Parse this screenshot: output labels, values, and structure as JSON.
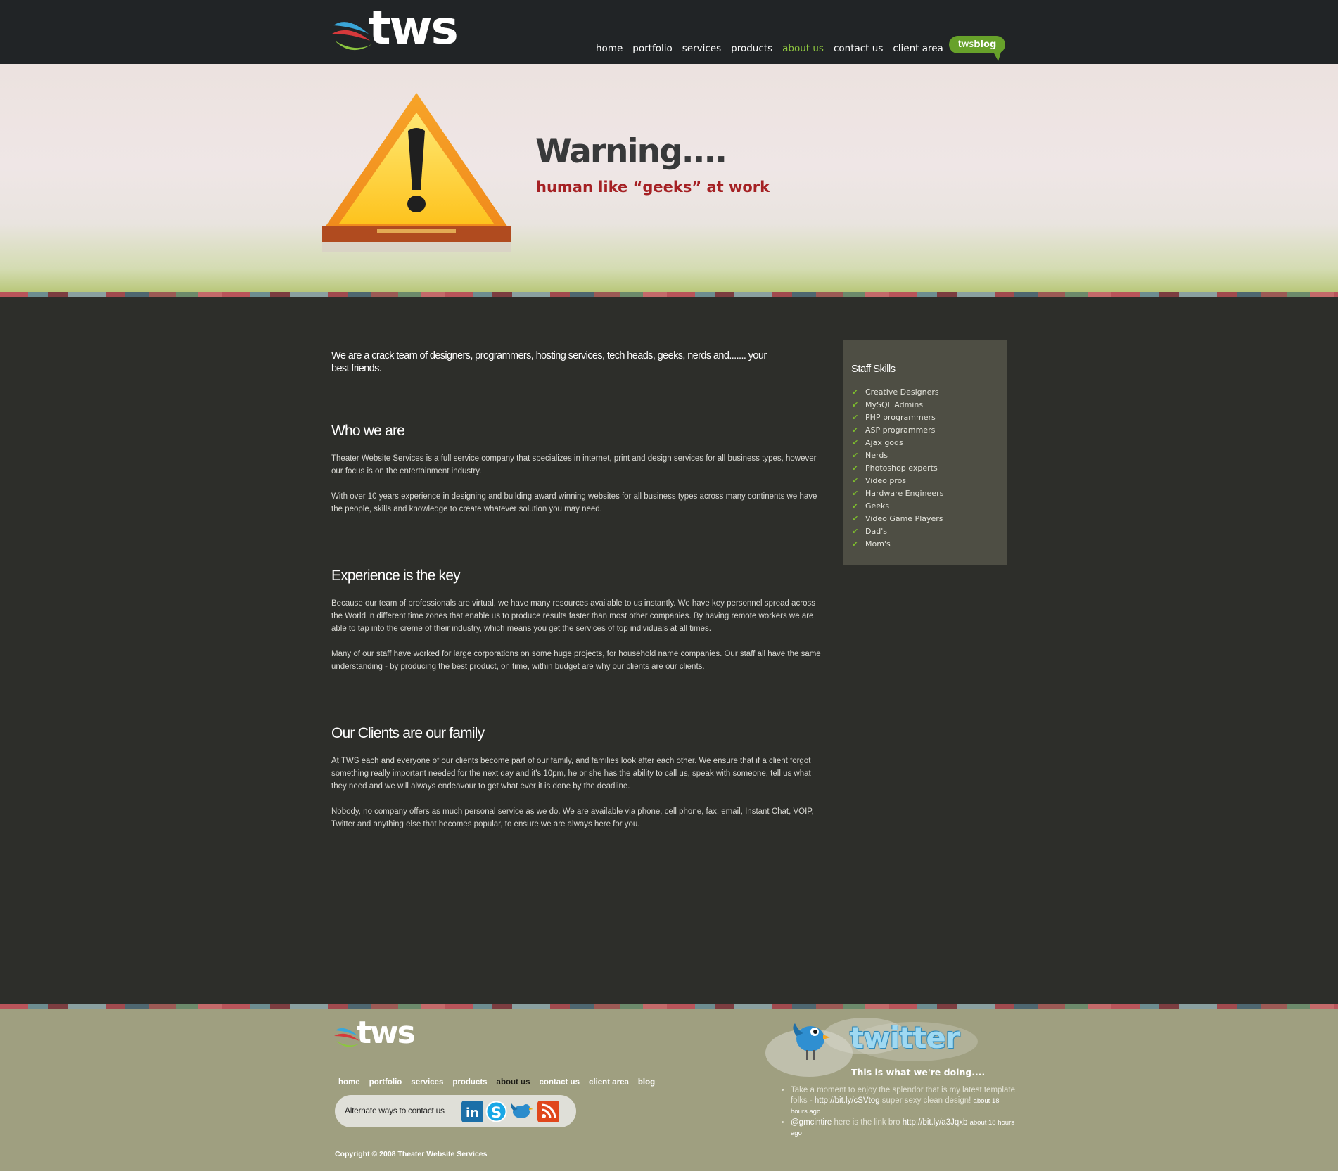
{
  "header": {
    "logo_text": "tws",
    "nav": [
      "home",
      "portfolio",
      "services",
      "products",
      "about us",
      "contact us",
      "client area"
    ],
    "active_nav": "about us",
    "blog_prefix": "tws",
    "blog_suffix": "blog"
  },
  "hero": {
    "title": "Warning....",
    "subtitle": "human like “geeks” at work"
  },
  "intro": "We are a crack team of designers, programmers, hosting services, tech heads, geeks, nerds and....... your best friends.",
  "sections": [
    {
      "heading": "Who we are",
      "paragraphs": [
        "Theater Website Services is a full service company that specializes in internet, print and design services for all business types, however our focus is on the entertainment industry.",
        "With over 10 years experience in designing and building award winning websites for all business types across many continents we have the people, skills and knowledge to create whatever solution you may need."
      ]
    },
    {
      "heading": "Experience is the key",
      "paragraphs": [
        "Because our team of professionals are virtual, we have many resources available to us instantly. We have key personnel spread across the World in different time zones that enable us to produce results faster than most other companies. By having remote workers we are able to tap into the creme of their industry, which means you get the services of top individuals at all times.",
        "Many of our staff have worked for large corporations on some huge projects, for household name companies. Our staff all have the same understanding - by producing the best product, on time, within budget are why our clients are our clients."
      ]
    },
    {
      "heading": "Our Clients are our family",
      "paragraphs": [
        "At TWS each and everyone of our clients become part of our family, and families look after each other. We ensure that if a client forgot something really important needed for the next day and it's 10pm, he or she has the ability to call us, speak with someone, tell us what they need and we will always endeavour to get what ever it is done by the deadline.",
        "Nobody, no company offers as much personal service as we do. We are available via phone, cell phone, fax, email, Instant Chat, VOIP, Twitter and anything else that becomes popular, to ensure we are always here for you."
      ]
    }
  ],
  "skills": {
    "title": "Staff Skills",
    "items": [
      "Creative Designers",
      "MySQL Admins",
      "PHP programmers",
      "ASP programmers",
      "Ajax gods",
      "Nerds",
      "Photoshop experts",
      "Video pros",
      "Hardware Engineers",
      "Geeks",
      "Video Game Players",
      "Dad's",
      "Mom's"
    ]
  },
  "footer": {
    "logo_text": "tws",
    "nav": [
      "home",
      "portfolio",
      "services",
      "products",
      "about us",
      "contact us",
      "client area",
      "blog"
    ],
    "active_nav": "about us",
    "contact_label": "Alternate ways to contact us",
    "social_icons": [
      "linkedin-icon",
      "skype-icon",
      "twitter-bird-icon",
      "rss-icon"
    ],
    "copyright": "Copyright © 2008 Theater Website Services",
    "twitter": {
      "wordmark": "twitter",
      "tagline": "This is what we're doing....",
      "tweets": [
        {
          "text": "Take a moment to enjoy the splendor that is my latest template folks - ",
          "link": "http://bit.ly/cSVtog",
          "text_after": " super sexy clean design!",
          "time": "about 18 hours ago"
        },
        {
          "handle": "@gmcintire",
          "text": " here is the link bro ",
          "link": "http://bit.ly/a3Jqxb",
          "time": "about 18 hours ago"
        }
      ]
    }
  },
  "colors": {
    "header_bg": "#212426",
    "main_bg": "#2d2e2a",
    "accent_green": "#8ec63f",
    "warning_red": "#a52124",
    "sidebar_bg": "#4e4e44",
    "footer_bg": "#9f9f80"
  }
}
